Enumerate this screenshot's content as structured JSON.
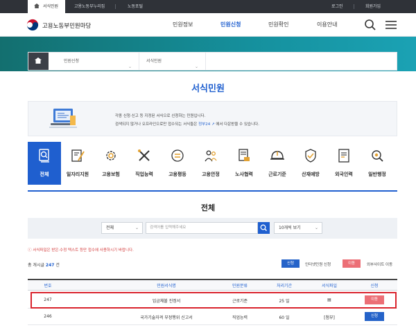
{
  "topbar": {
    "tabs": [
      {
        "label": "서식민원"
      },
      {
        "label": "고용노동부누리집"
      },
      {
        "label": "노동포털"
      }
    ],
    "right": [
      {
        "label": "로그인"
      },
      {
        "label": "회원가입"
      }
    ]
  },
  "header": {
    "brand": "고용노동부민원마당",
    "nav": [
      {
        "label": "민원정보"
      },
      {
        "label": "민원신청"
      },
      {
        "label": "민원확인"
      },
      {
        "label": "이용안내"
      }
    ],
    "active_nav": "민원신청"
  },
  "breadcrumb": {
    "items": [
      {
        "label": "민원신청"
      },
      {
        "label": "서식민원"
      }
    ]
  },
  "page": {
    "title": "서식민원"
  },
  "notice": {
    "line1": "각종 신청·신고 등 지정된 서식으로 신청하는 민원입니다.",
    "line2a": "검색되지 않거나 오프라인으로만 접수되는 서식들은",
    "line2_link": "정부24",
    "line2b": "에서 다운받을 수 있습니다."
  },
  "categories": [
    {
      "label": "전체",
      "icon": "search-document-icon",
      "active": true
    },
    {
      "label": "일자리지원",
      "icon": "pen-document-icon"
    },
    {
      "label": "고용보험",
      "icon": "gear-icon"
    },
    {
      "label": "직업능력",
      "icon": "tools-icon"
    },
    {
      "label": "고용평등",
      "icon": "equality-icon"
    },
    {
      "label": "고용안정",
      "icon": "people-icon"
    },
    {
      "label": "노사협력",
      "icon": "contract-icon"
    },
    {
      "label": "근로기준",
      "icon": "helmet-icon"
    },
    {
      "label": "산재예방",
      "icon": "safety-icon"
    },
    {
      "label": "외국인력",
      "icon": "foreign-document-icon"
    },
    {
      "label": "일반행정",
      "icon": "admin-search-icon"
    }
  ],
  "section": {
    "title": "전체"
  },
  "search": {
    "scope": "전체",
    "placeholder": "검색어를 입력해주세요",
    "page_size": "10개씩 보기"
  },
  "warning": "서식파일은 받은·수정 텍스트 등만 접수에 사용하시기 바랍니다.",
  "summary": {
    "label": "총 개시글",
    "count": "247",
    "unit": "건"
  },
  "legend": [
    {
      "box": "신청",
      "text": "인터넷민원 신청",
      "color": "#2563c9"
    },
    {
      "box": "이동",
      "text": "외부사이트 이동",
      "color": "#ec6f76"
    }
  ],
  "table": {
    "headers": [
      "번호",
      "민원서식명",
      "민원분류",
      "처리기간",
      "서식파일",
      "신청"
    ],
    "rows": [
      {
        "no": "247",
        "name": "임금체불 진정서",
        "category": "근로기준",
        "period": "25 일",
        "file": "▤",
        "action": "이동",
        "action_color": "#ec6f76"
      },
      {
        "no": "246",
        "name": "국가기술자격 부정행위 신고서",
        "category": "직업능력",
        "period": "60 일",
        "file": "[첨부]",
        "action": "신청",
        "action_color": "#2563c9"
      }
    ]
  },
  "colors": {
    "primary": "#1f5fcf",
    "topbar": "#2f3238",
    "banner": "#15909d",
    "alert": "#d9232d"
  }
}
